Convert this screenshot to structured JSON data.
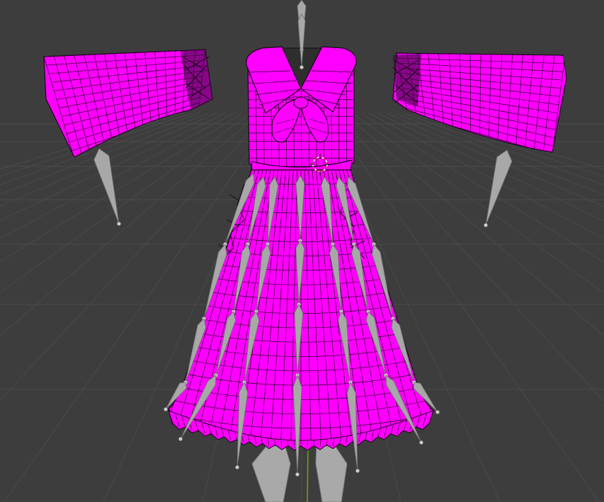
{
  "viewport": {
    "name": "3D Viewport",
    "background": "#3d3d3d",
    "grid_color": "#4a4a4a",
    "mesh_color": "#ff00ff",
    "wire_color": "#1a001a",
    "bone_color": "#a8a8a8",
    "x_axis_color": "#6fa800",
    "object": {
      "type": "garment mesh",
      "parts": [
        "dress",
        "left-sleeve",
        "right-sleeve",
        "collar",
        "bow",
        "skirt-frill",
        "lacing"
      ]
    },
    "armature": {
      "shown": true,
      "bone_groups": [
        "spine",
        "left-arm",
        "right-arm",
        "skirt",
        "legs"
      ]
    },
    "cursor_3d": {
      "icon": "3d-cursor-icon"
    }
  }
}
